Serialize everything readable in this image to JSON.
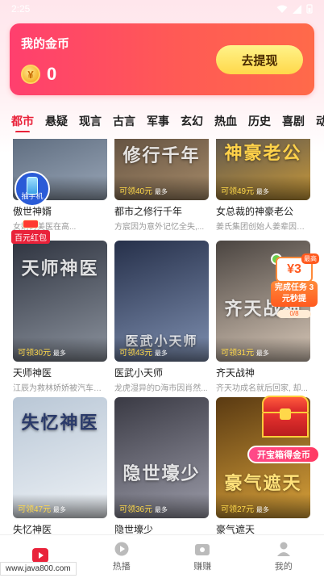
{
  "status_bar": {
    "time": "2:25"
  },
  "coin_card": {
    "title": "我的金币",
    "coin_symbol": "¥",
    "coin_value": "0",
    "withdraw_label": "去提现"
  },
  "tabs": [
    {
      "label": "都市",
      "active": true
    },
    {
      "label": "悬疑"
    },
    {
      "label": "现言"
    },
    {
      "label": "古言"
    },
    {
      "label": "军事"
    },
    {
      "label": "玄幻"
    },
    {
      "label": "热血"
    },
    {
      "label": "历史"
    },
    {
      "label": "喜剧"
    },
    {
      "label": "动作"
    }
  ],
  "dramas": [
    {
      "title": "傲世神婿",
      "desc": "女婿的美医在高...",
      "reward": "可领",
      "poster_text": "",
      "c1": "#3b4a5e",
      "c2": "#9aa7b8"
    },
    {
      "title": "都市之修行千年",
      "desc": "方宸因为意外记忆全失,...",
      "reward": "可领40元",
      "reward_more": "最多",
      "poster_text": "修行千年",
      "c1": "#3a2f2a",
      "c2": "#a98d6a"
    },
    {
      "title": "女总裁的神豪老公",
      "desc": "姜氏集团创始人姜辈因被...",
      "reward": "可领49元",
      "reward_more": "最多",
      "poster_text": "神豪老公",
      "c1": "#1f2f5a",
      "c2": "#c99a3a"
    },
    {
      "title": "天师神医",
      "desc": "江辰为救林娇娇被汽车撞...",
      "reward": "可领30元",
      "reward_more": "最多",
      "poster_text": "天师神医",
      "c1": "#2f3440",
      "c2": "#8c939e"
    },
    {
      "title": "医武小天师",
      "desc": "龙虎湿异的D海市因肖然...",
      "reward": "可领43元",
      "reward_more": "最多",
      "poster_text": "医武小天师",
      "c1": "#26304a",
      "c2": "#7e8fb0"
    },
    {
      "title": "齐天战神",
      "desc": "齐天功成名就后回家, 却...",
      "reward": "可领31元",
      "reward_more": "最多",
      "poster_text": "齐天战神",
      "c1": "#4a4440",
      "c2": "#d8c8b8"
    },
    {
      "title": "失忆神医",
      "desc": "",
      "reward": "可领47元",
      "reward_more": "最多",
      "poster_text": "失忆神医",
      "c1": "#b9c7d6",
      "c2": "#eef2f6"
    },
    {
      "title": "隐世壕少",
      "desc": "",
      "reward": "可领36元",
      "reward_more": "最多",
      "poster_text": "隐世壕少",
      "c1": "#3a3a44",
      "c2": "#9b9ba8"
    },
    {
      "title": "豪气遮天",
      "desc": "",
      "reward": "可领27元",
      "reward_more": "最多",
      "poster_text": "豪气遮天",
      "c1": "#5a3a12",
      "c2": "#d9a23a"
    }
  ],
  "overlays": {
    "phone_badge": "抽手机",
    "redpack_label": "百元红包",
    "task_money": "¥3",
    "task_hot": "最高",
    "task_text": "完成任务 3元秒提",
    "task_progress": "0/8",
    "treasure_label": "开宝箱得金币"
  },
  "bottom_nav": [
    {
      "label": "",
      "icon": "play-icon",
      "active": true
    },
    {
      "label": "热播",
      "icon": "play-circle-icon"
    },
    {
      "label": "赚赚",
      "icon": "wallet-icon"
    },
    {
      "label": "我的",
      "icon": "user-icon"
    }
  ],
  "watermark": "www.java800.com",
  "colors": {
    "accent": "#e9223a",
    "card_gradient_start": "#ff3f6e",
    "card_gradient_end": "#ff6a4a",
    "withdraw_button": "#ffd84a"
  }
}
